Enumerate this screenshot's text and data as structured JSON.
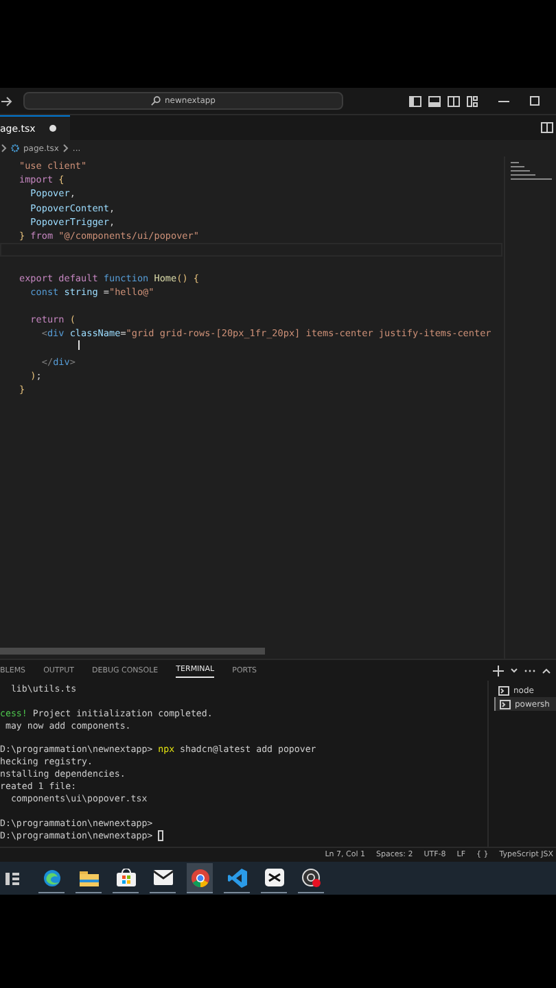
{
  "title_bar": {
    "search": "newnextapp"
  },
  "tabs": [
    {
      "label": "age.tsx",
      "selected": true,
      "modified": true
    }
  ],
  "breadcrumb": {
    "file": "page.tsx",
    "more": "..."
  },
  "code_lines": [
    {
      "kind": "code",
      "tokens": [
        {
          "text": "\"use client\"",
          "kind": "string"
        }
      ]
    },
    {
      "kind": "code",
      "tokens": [
        {
          "text": "import",
          "kind": "control"
        },
        {
          "text": " {",
          "kind": "bracket"
        }
      ]
    },
    {
      "kind": "code",
      "tokens": [
        {
          "text": "  Popover",
          "kind": "variable"
        },
        {
          "text": ",",
          "kind": "plain"
        }
      ]
    },
    {
      "kind": "code",
      "tokens": [
        {
          "text": "  PopoverContent",
          "kind": "variable"
        },
        {
          "text": ",",
          "kind": "plain"
        }
      ]
    },
    {
      "kind": "code",
      "tokens": [
        {
          "text": "  PopoverTrigger",
          "kind": "variable"
        },
        {
          "text": ",",
          "kind": "plain"
        }
      ]
    },
    {
      "kind": "code",
      "tokens": [
        {
          "text": "}",
          "kind": "bracket"
        },
        {
          "text": " from ",
          "kind": "control"
        },
        {
          "text": "\"@/components/ui/popover\"",
          "kind": "string"
        }
      ]
    },
    {
      "kind": "current_blank"
    },
    {
      "kind": "blank"
    },
    {
      "kind": "code",
      "tokens": [
        {
          "text": "export default ",
          "kind": "control"
        },
        {
          "text": "function ",
          "kind": "storage"
        },
        {
          "text": "Home",
          "kind": "func"
        },
        {
          "text": "() ",
          "kind": "bracket"
        },
        {
          "text": "{",
          "kind": "bracket"
        }
      ]
    },
    {
      "kind": "code",
      "tokens": [
        {
          "text": "  const ",
          "kind": "storage"
        },
        {
          "text": "string ",
          "kind": "variable"
        },
        {
          "text": "=",
          "kind": "plain"
        },
        {
          "text": "\"hello@\"",
          "kind": "string"
        }
      ]
    },
    {
      "kind": "blank"
    },
    {
      "kind": "code",
      "tokens": [
        {
          "text": "  return ",
          "kind": "control"
        },
        {
          "text": "(",
          "kind": "bracket"
        }
      ]
    },
    {
      "kind": "code",
      "tokens": [
        {
          "text": "    <",
          "kind": "punct"
        },
        {
          "text": "div ",
          "kind": "storage"
        },
        {
          "text": "className",
          "kind": "variable"
        },
        {
          "text": "=",
          "kind": "plain"
        },
        {
          "text": "\"grid grid-rows-[20px_1fr_20px] items-center justify-items-center",
          "kind": "string"
        }
      ]
    },
    {
      "kind": "blank"
    },
    {
      "kind": "code",
      "tokens": [
        {
          "text": "    </",
          "kind": "punct"
        },
        {
          "text": "div",
          "kind": "storage"
        },
        {
          "text": ">",
          "kind": "punct"
        }
      ]
    },
    {
      "kind": "code",
      "tokens": [
        {
          "text": "  )",
          "kind": "bracket"
        },
        {
          "text": ";",
          "kind": "plain"
        }
      ]
    },
    {
      "kind": "code",
      "tokens": [
        {
          "text": "}",
          "kind": "bracket"
        }
      ]
    }
  ],
  "panel_tabs": [
    {
      "label": "BLEMS",
      "selected": false
    },
    {
      "label": "OUTPUT",
      "selected": false
    },
    {
      "label": "DEBUG CONSOLE",
      "selected": false
    },
    {
      "label": "TERMINAL",
      "selected": true
    },
    {
      "label": "PORTS",
      "selected": false
    }
  ],
  "terminal_lines": [
    {
      "kind": "text",
      "segments": [
        {
          "text": "  lib\\utils.ts",
          "kind": "plain"
        }
      ]
    },
    {
      "kind": "blank"
    },
    {
      "kind": "text",
      "segments": [
        {
          "text": "cess!",
          "kind": "success"
        },
        {
          "text": " Project initialization completed.",
          "kind": "plain"
        }
      ]
    },
    {
      "kind": "text",
      "segments": [
        {
          "text": " may now add components.",
          "kind": "plain"
        }
      ]
    },
    {
      "kind": "blank"
    },
    {
      "kind": "text",
      "segments": [
        {
          "text": "D:\\programmation\\newnextapp> ",
          "kind": "plain"
        },
        {
          "text": "npx",
          "kind": "command"
        },
        {
          "text": " shadcn@latest add popover",
          "kind": "plain"
        }
      ]
    },
    {
      "kind": "text",
      "segments": [
        {
          "text": "hecking registry.",
          "kind": "plain"
        }
      ]
    },
    {
      "kind": "text",
      "segments": [
        {
          "text": "nstalling dependencies.",
          "kind": "plain"
        }
      ]
    },
    {
      "kind": "text",
      "segments": [
        {
          "text": "reated 1 file:",
          "kind": "plain"
        }
      ]
    },
    {
      "kind": "text",
      "segments": [
        {
          "text": "  components\\ui\\popover.tsx",
          "kind": "plain"
        }
      ]
    },
    {
      "kind": "blank"
    },
    {
      "kind": "text",
      "segments": [
        {
          "text": "D:\\programmation\\newnextapp>",
          "kind": "plain"
        }
      ]
    },
    {
      "kind": "prompt",
      "segments": [
        {
          "text": "D:\\programmation\\newnextapp> ",
          "kind": "plain"
        }
      ]
    }
  ],
  "terminals": [
    {
      "label": "node",
      "selected": false
    },
    {
      "label": "powersh",
      "selected": true
    }
  ],
  "status_bar": [
    "Ln 7, Col 1",
    "Spaces: 2",
    "UTF-8",
    "LF",
    "{ }",
    "TypeScript JSX"
  ],
  "taskbar": [
    {
      "kind": "edge",
      "selected": false
    },
    {
      "kind": "folder",
      "selected": false
    },
    {
      "kind": "store",
      "selected": false
    },
    {
      "kind": "mail",
      "selected": false
    },
    {
      "kind": "chrome",
      "selected": true
    },
    {
      "kind": "vscode",
      "selected": false
    },
    {
      "kind": "capcut",
      "selected": false
    },
    {
      "kind": "recorder",
      "selected": false
    }
  ]
}
